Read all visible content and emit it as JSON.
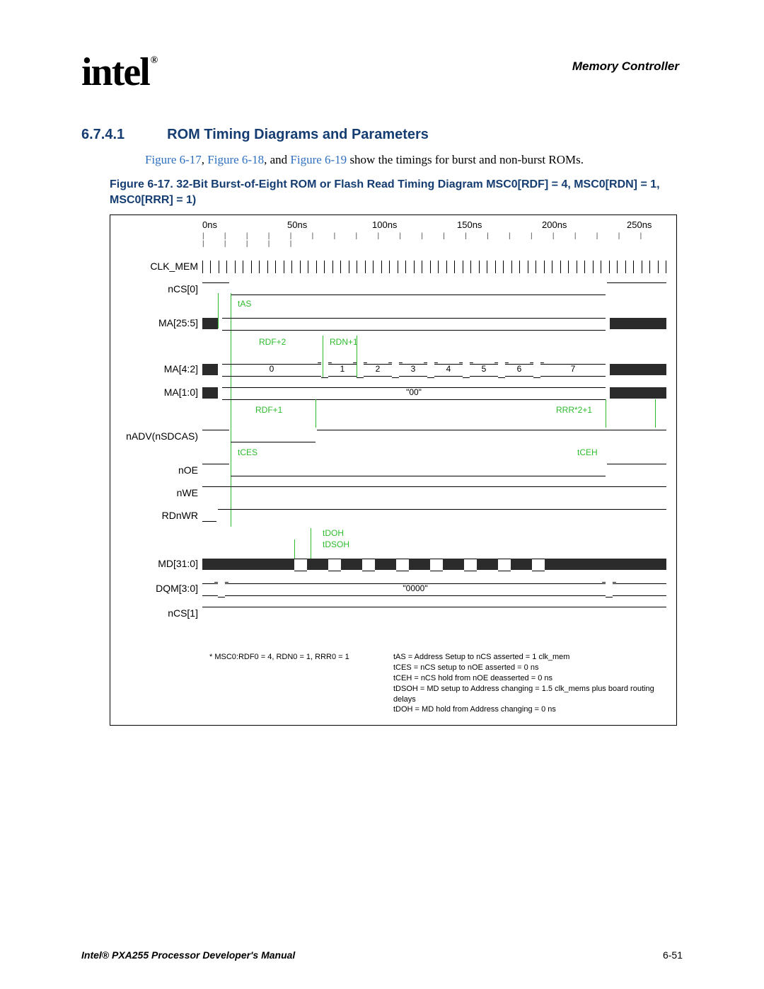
{
  "header": {
    "logo": "intel",
    "reg": "®",
    "right": "Memory Controller"
  },
  "section": {
    "num": "6.7.4.1",
    "title": "ROM Timing Diagrams and Parameters"
  },
  "body": {
    "pre": "",
    "link1": "Figure 6-17",
    "sep1": ", ",
    "link2": "Figure 6-18",
    "sep2": ", and ",
    "link3": "Figure 6-19",
    "post": " show the timings for burst and non-burst ROMs."
  },
  "figcaption": "Figure 6-17. 32-Bit Burst-of-Eight ROM or Flash Read Timing Diagram MSC0[RDF] = 4, MSC0[RDN] = 1, MSC0[RRR] = 1)",
  "timescale": {
    "t0": "0ns",
    "t1": "50ns",
    "t2": "100ns",
    "t3": "150ns",
    "t4": "200ns",
    "t5": "250ns"
  },
  "signals": {
    "clk": "CLK_MEM",
    "ncs0": "nCS[0]",
    "ma25": "MA[25:5]",
    "ma42": "MA[4:2]",
    "ma10": "MA[1:0]",
    "nadv": "nADV(nSDCAS)",
    "noe": "nOE",
    "nwe": "nWE",
    "rdnwr": "RDnWR",
    "md": "MD[31:0]",
    "dqm": "DQM[3:0]",
    "ncs1": "nCS[1]"
  },
  "busvals": {
    "ma42_0": "0",
    "ma42_1": "1",
    "ma42_2": "2",
    "ma42_3": "3",
    "ma42_4": "4",
    "ma42_5": "5",
    "ma42_6": "6",
    "ma42_7": "7",
    "ma10": "\"00\"",
    "dqm": "\"0000\""
  },
  "ann": {
    "tas": "tAS",
    "rdf2": "RDF+2",
    "rdn1": "RDN+1",
    "rdf1": "RDF+1",
    "rrr": "RRR*2+1",
    "tces": "tCES",
    "tceh": "tCEH",
    "tdoh": "tDOH",
    "tdsoh": "tDSOH"
  },
  "notes": {
    "left": "* MSC0:RDF0 = 4, RDN0 = 1, RRR0 = 1",
    "r1": "tAS = Address Setup to nCS asserted = 1 clk_mem",
    "r2": "tCES = nCS setup to nOE asserted = 0 ns",
    "r3": "tCEH = nCS hold from nOE deasserted = 0 ns",
    "r4": "tDSOH = MD setup to Address changing = 1.5 clk_mems plus board routing delays",
    "r5": "tDOH = MD hold from Address changing = 0 ns"
  },
  "footer": {
    "left": "Intel® PXA255 Processor Developer's Manual",
    "right": "6-51"
  }
}
